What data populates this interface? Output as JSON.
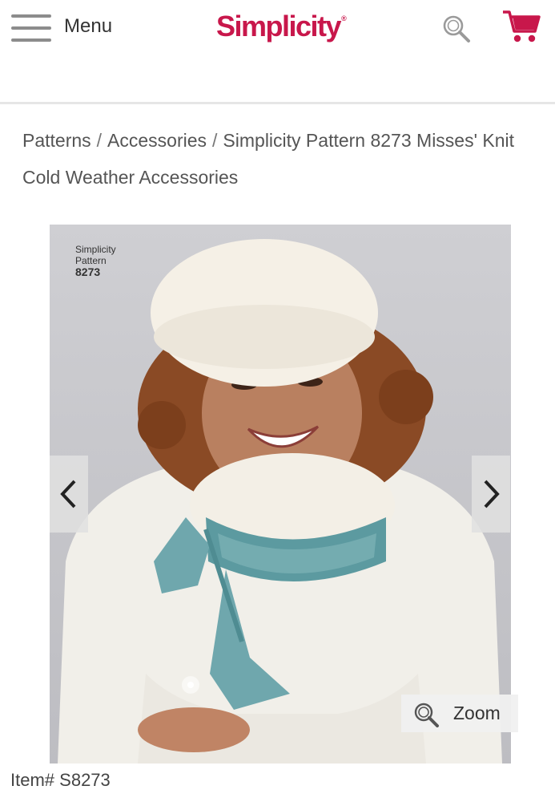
{
  "header": {
    "menu_label": "Menu",
    "logo_text": "Simplicity",
    "logo_mark": "®",
    "brand_color": "#c8174b",
    "icons": [
      "hamburger-icon",
      "search-icon",
      "cart-icon"
    ]
  },
  "breadcrumb": {
    "separator": "/",
    "items": [
      "Patterns",
      "Accessories",
      "Simplicity Pattern 8273 Misses' Knit Cold Weather Accessories"
    ]
  },
  "gallery": {
    "pattern_label_line1": "Simplicity",
    "pattern_label_line2": "Pattern",
    "pattern_label_number": "8273",
    "zoom_label": "Zoom",
    "icons": [
      "chevron-left-icon",
      "chevron-right-icon",
      "zoom-icon"
    ]
  },
  "product": {
    "item_label": "Item#",
    "item_number": "S8273"
  }
}
